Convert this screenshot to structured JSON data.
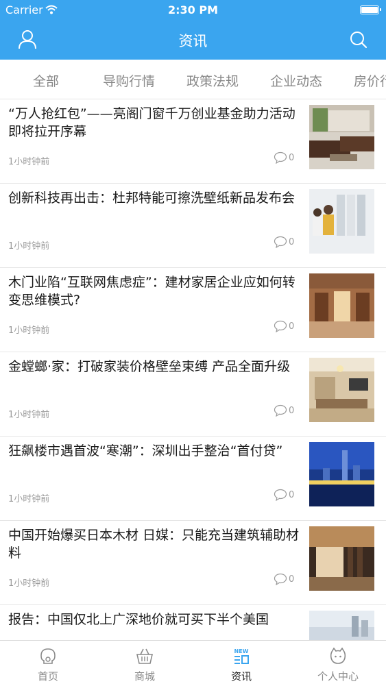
{
  "status_bar": {
    "carrier": "Carrier",
    "time": "2:30 PM"
  },
  "nav": {
    "title": "资讯",
    "left_icon": "user-icon",
    "right_icon": "search-icon",
    "accent": "#3aa5ef"
  },
  "tabs": [
    "全部",
    "导购行情",
    "政策法规",
    "企业动态",
    "房价行"
  ],
  "articles": [
    {
      "title": "“万人抢红包”——亮阁门窗千万创业基金助力活动即将拉开序幕",
      "time": "1小时钟前",
      "comments": "0"
    },
    {
      "title": "创新科技再出击：杜邦特能可擦洗壁纸新品发布会",
      "time": "1小时钟前",
      "comments": "0"
    },
    {
      "title": "木门业陷“互联网焦虑症”：建材家居企业应如何转变思维模式?",
      "time": "1小时钟前",
      "comments": "0"
    },
    {
      "title": "金螳螂·家：打破家装价格壁垒束缚 产品全面升级",
      "time": "1小时钟前",
      "comments": "0"
    },
    {
      "title": "狂飙楼市遇首波“寒潮”：深圳出手整治“首付贷”",
      "time": "1小时钟前",
      "comments": "0"
    },
    {
      "title": "中国开始爆买日本木材 日媒：只能充当建筑辅助材料",
      "time": "1小时钟前",
      "comments": "0"
    },
    {
      "title": "报告：中国仅北上广深地价就可买下半个美国",
      "time": "",
      "comments": ""
    }
  ],
  "tabbar": [
    {
      "label": "首页",
      "icon": "home-icon"
    },
    {
      "label": "商城",
      "icon": "basket-icon"
    },
    {
      "label": "资讯",
      "icon": "news-icon",
      "badge": "NEW"
    },
    {
      "label": "个人中心",
      "icon": "profile-icon"
    }
  ]
}
